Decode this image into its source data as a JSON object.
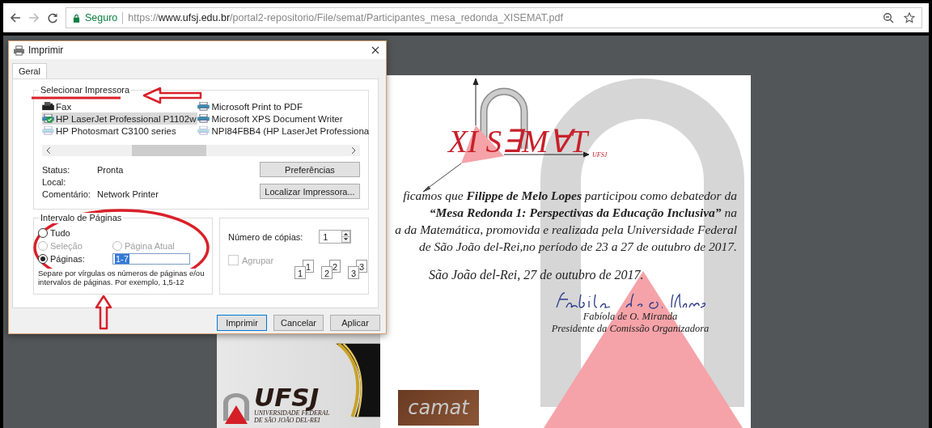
{
  "browser": {
    "secure_label": "Seguro",
    "url_scheme": "https://",
    "url_host": "www.ufsj.edu.br",
    "url_path": "/portal2-repositorio/File/semat/Participantes_mesa_redonda_XISEMAT.pdf"
  },
  "pdf": {
    "logo_text": "XI S∃M∀T",
    "logo_sub": "UFSJ",
    "lines": [
      "ficamos que **Filippe de Melo Lopes** participou como debatedor da",
      "**“Mesa Redonda 1: Perspectivas da Educação Inclusiva”** na",
      "a da Matemática, promovida e realizada pela Universidade Federal",
      "de São João del-Rei,no período de 23 a 27 de outubro de 2017."
    ],
    "date": "São João del-Rei, 27 de outubro de 2017.",
    "signer": "Fabíola de O. Miranda",
    "signer_role": "Presidente da Comissão Organizadora",
    "ufsj_name": "UFSJ",
    "ufsj_line_1": "UNIVERSIDADE FEDERAL",
    "ufsj_line_2": "DE SÃO JOÃO DEL-REI",
    "camat": "camat"
  },
  "dialog": {
    "title": "Imprimir",
    "tabs": [
      {
        "label": "Geral",
        "selected": true
      }
    ],
    "printer_group": "Selecionar Impressora",
    "printers": [
      {
        "name": "Fax",
        "kind": "fax",
        "default": false,
        "offline": false,
        "selected": false
      },
      {
        "name": "HP LaserJet Professional P1102w",
        "kind": "printer",
        "default": true,
        "offline": false,
        "selected": true
      },
      {
        "name": "HP Photosmart C3100 series",
        "kind": "printer",
        "default": false,
        "offline": true,
        "selected": false
      },
      {
        "name": "Microsoft Print to PDF",
        "kind": "printer",
        "default": false,
        "offline": false,
        "selected": false
      },
      {
        "name": "Microsoft XPS Document Writer",
        "kind": "printer",
        "default": false,
        "offline": false,
        "selected": false
      },
      {
        "name": "NPI84FBB4 (HP LaserJet Professiona",
        "kind": "printer",
        "default": false,
        "offline": true,
        "selected": false
      }
    ],
    "status": [
      {
        "label": "Status:",
        "value": "Pronta"
      },
      {
        "label": "Local:"
      },
      {
        "label": "Comentário:",
        "value": "Network Printer"
      }
    ],
    "printer_buttons": [
      "Preferências",
      "Localizar Impressora..."
    ],
    "range_group": "Intervalo de Páginas",
    "range_options": [
      {
        "label": "Tudo",
        "selected": false,
        "disabled": false
      },
      {
        "label": "Seleção",
        "selected": false,
        "disabled": true
      },
      {
        "label": "Página Atual",
        "selected": false,
        "disabled": true
      },
      {
        "label": "Páginas:",
        "selected": true,
        "disabled": false
      }
    ],
    "pages_value": "1-7",
    "range_hint": "Separe por vírgulas os números de páginas e/ou intervalos de páginas. Por exemplo, 1,5-12",
    "copies_label": "Número de cópias:",
    "copies_value": "1",
    "collate": {
      "label": "Agrupar",
      "checked": false,
      "disabled": true
    },
    "collate_sets": [
      {
        "back": "1",
        "front": "1"
      },
      {
        "back": "2",
        "front": "2"
      },
      {
        "back": "3",
        "front": "3"
      }
    ],
    "buttons": [
      {
        "label": "Imprimir",
        "default": true
      },
      {
        "label": "Cancelar",
        "default": false
      },
      {
        "label": "Aplicar",
        "default": false
      }
    ]
  }
}
